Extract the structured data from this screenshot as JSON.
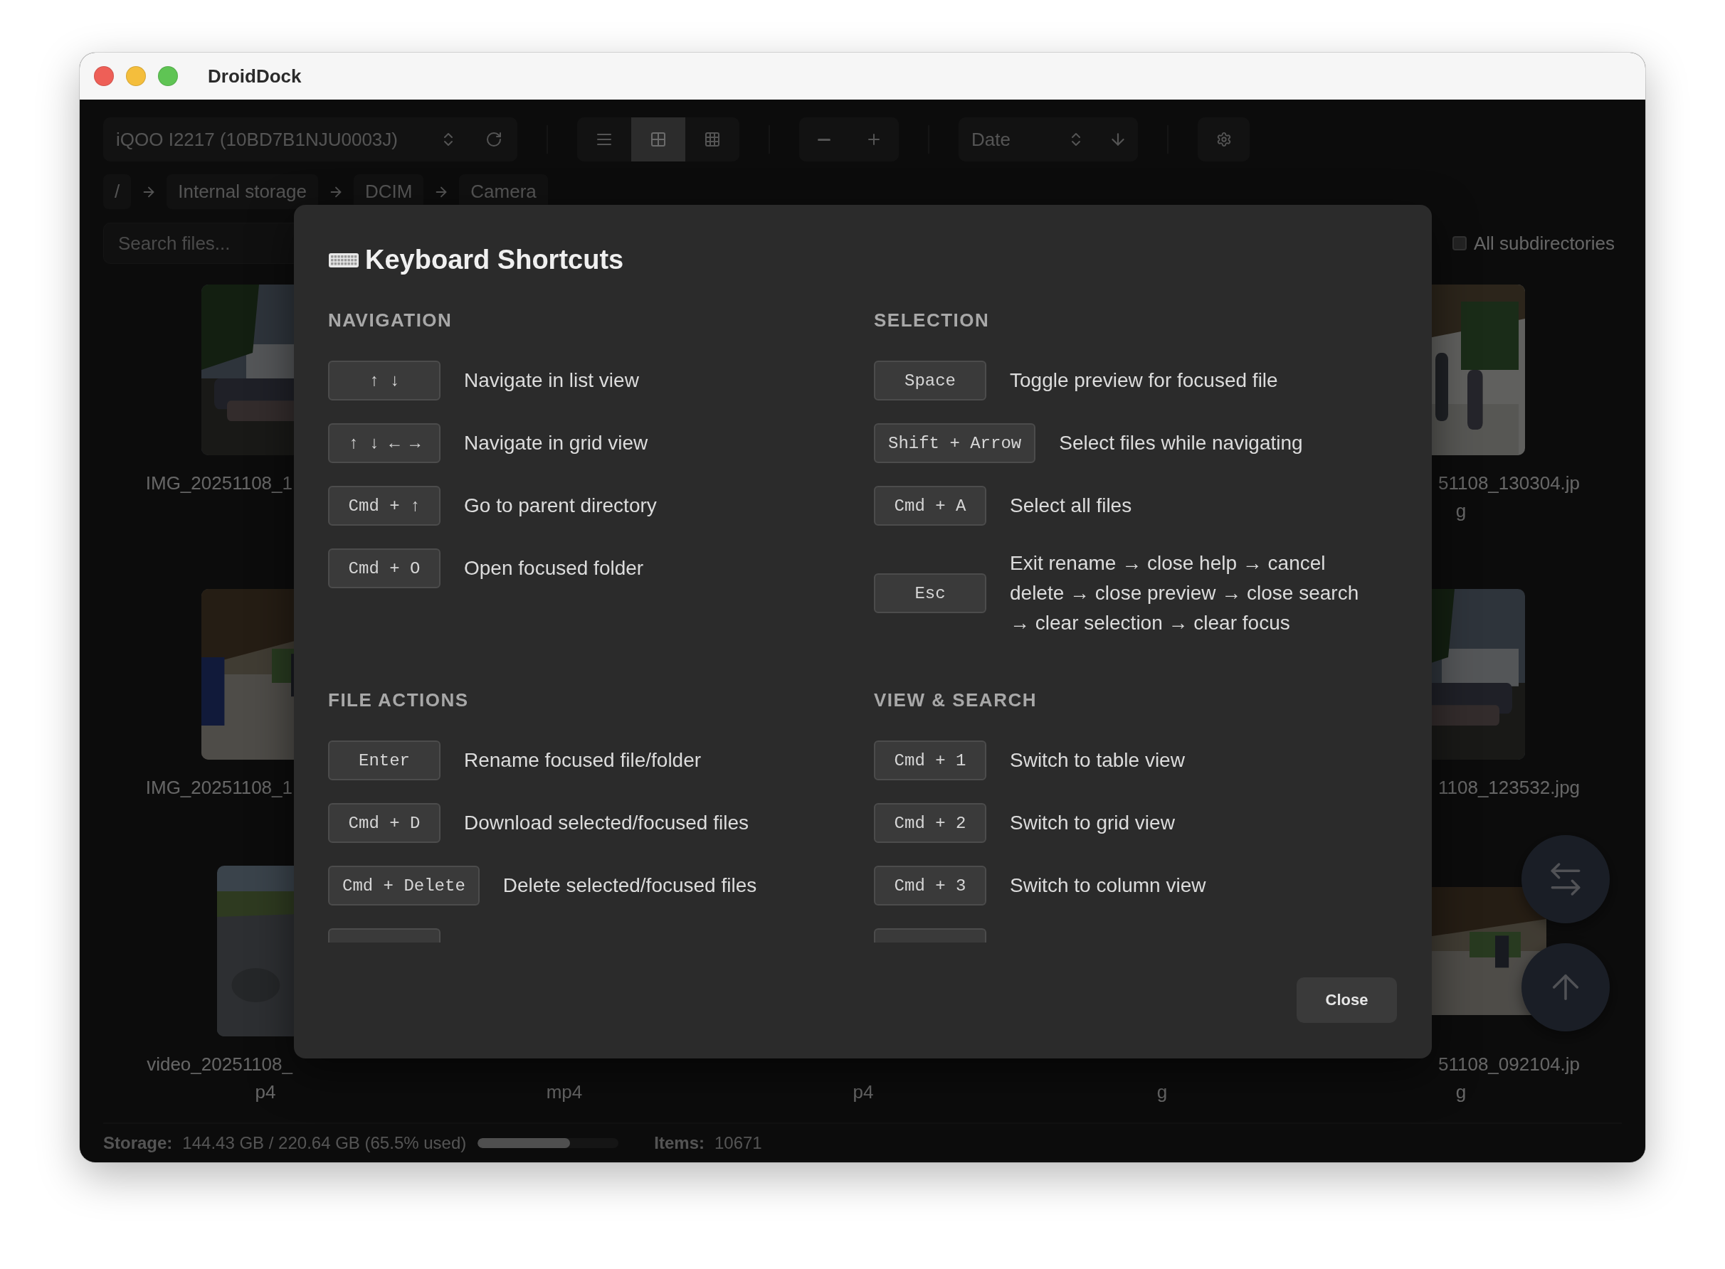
{
  "window": {
    "title": "DroidDock"
  },
  "toolbar": {
    "device": "iQOO I2217 (10BD7B1NJU0003J)",
    "view_modes": [
      {
        "kind": "list",
        "selected": false
      },
      {
        "kind": "grid",
        "selected": true
      },
      {
        "kind": "columns",
        "selected": false
      }
    ],
    "sort": "Date"
  },
  "breadcrumbs": [
    "/",
    "Internal storage",
    "DCIM",
    "Camera"
  ],
  "search": {
    "placeholder": "Search files...",
    "all_subdirectories": {
      "label": "All subdirectories",
      "checked": false
    }
  },
  "file_grid": [
    {
      "first": {
        "kind": "picture",
        "name": "IMG_20251108_1"
      },
      "last": {
        "kind": "picture",
        "name": "51108_130304.jp",
        "name_tail": "g"
      }
    },
    {
      "first": {
        "kind": "picture",
        "name": "IMG_20251108_1"
      },
      "last": {
        "kind": "picture",
        "name": "1108_123532.jpg"
      }
    },
    {
      "first": {
        "kind": "picture",
        "name": "video_20251108_",
        "name_tail": "p4"
      },
      "middle": [
        {
          "name_tail": "mp4"
        },
        {
          "name_tail": "p4"
        },
        {
          "name_tail": "g"
        }
      ],
      "last": {
        "kind": "picture",
        "name": "51108_092104.jp",
        "name_tail": "g"
      }
    }
  ],
  "status_bar": {
    "storage_label": "Storage:",
    "storage_value": "144.43 GB / 220.64 GB (65.5% used)",
    "level": 0.655,
    "items_label": "Items:",
    "items_value": "10671"
  },
  "dialog": {
    "title": "Keyboard Shortcuts",
    "sections": [
      {
        "title": "NAVIGATION",
        "shortcuts": [
          {
            "kind": "shortcut",
            "keys": "↑ ↓",
            "description": "Navigate in list view"
          },
          {
            "kind": "shortcut",
            "keys": "↑ ↓ ← →",
            "description": "Navigate in grid view"
          },
          {
            "kind": "shortcut",
            "keys": "Cmd + ↑",
            "description": "Go to parent directory"
          },
          {
            "kind": "shortcut",
            "keys": "Cmd + O",
            "description": "Open focused folder"
          }
        ]
      },
      {
        "title": "SELECTION",
        "shortcuts": [
          {
            "kind": "shortcut",
            "keys": "Space",
            "description": "Toggle preview for focused file"
          },
          {
            "kind": "shortcut",
            "keys": "Shift + Arrow",
            "description": "Select files while navigating"
          },
          {
            "kind": "shortcut",
            "keys": "Cmd + A",
            "description": "Select all files"
          },
          {
            "kind": "shortcut",
            "keys": "Esc",
            "description": "Exit rename → close help → cancel delete → close preview → close search → clear selection → clear focus"
          }
        ]
      },
      {
        "title": "FILE ACTIONS",
        "shortcuts": [
          {
            "kind": "shortcut",
            "keys": "Enter",
            "description": "Rename focused file/folder"
          },
          {
            "kind": "shortcut",
            "keys": "Cmd + D",
            "description": "Download selected/focused files"
          },
          {
            "kind": "shortcut",
            "keys": "Cmd + Delete",
            "description": "Delete selected/focused files"
          },
          {
            "kind": "clipped"
          }
        ]
      },
      {
        "title": "VIEW & SEARCH",
        "shortcuts": [
          {
            "kind": "shortcut",
            "keys": "Cmd + 1",
            "description": "Switch to table view"
          },
          {
            "kind": "shortcut",
            "keys": "Cmd + 2",
            "description": "Switch to grid view"
          },
          {
            "kind": "shortcut",
            "keys": "Cmd + 3",
            "description": "Switch to column view"
          },
          {
            "kind": "clipped"
          }
        ]
      }
    ],
    "close": "Close"
  }
}
